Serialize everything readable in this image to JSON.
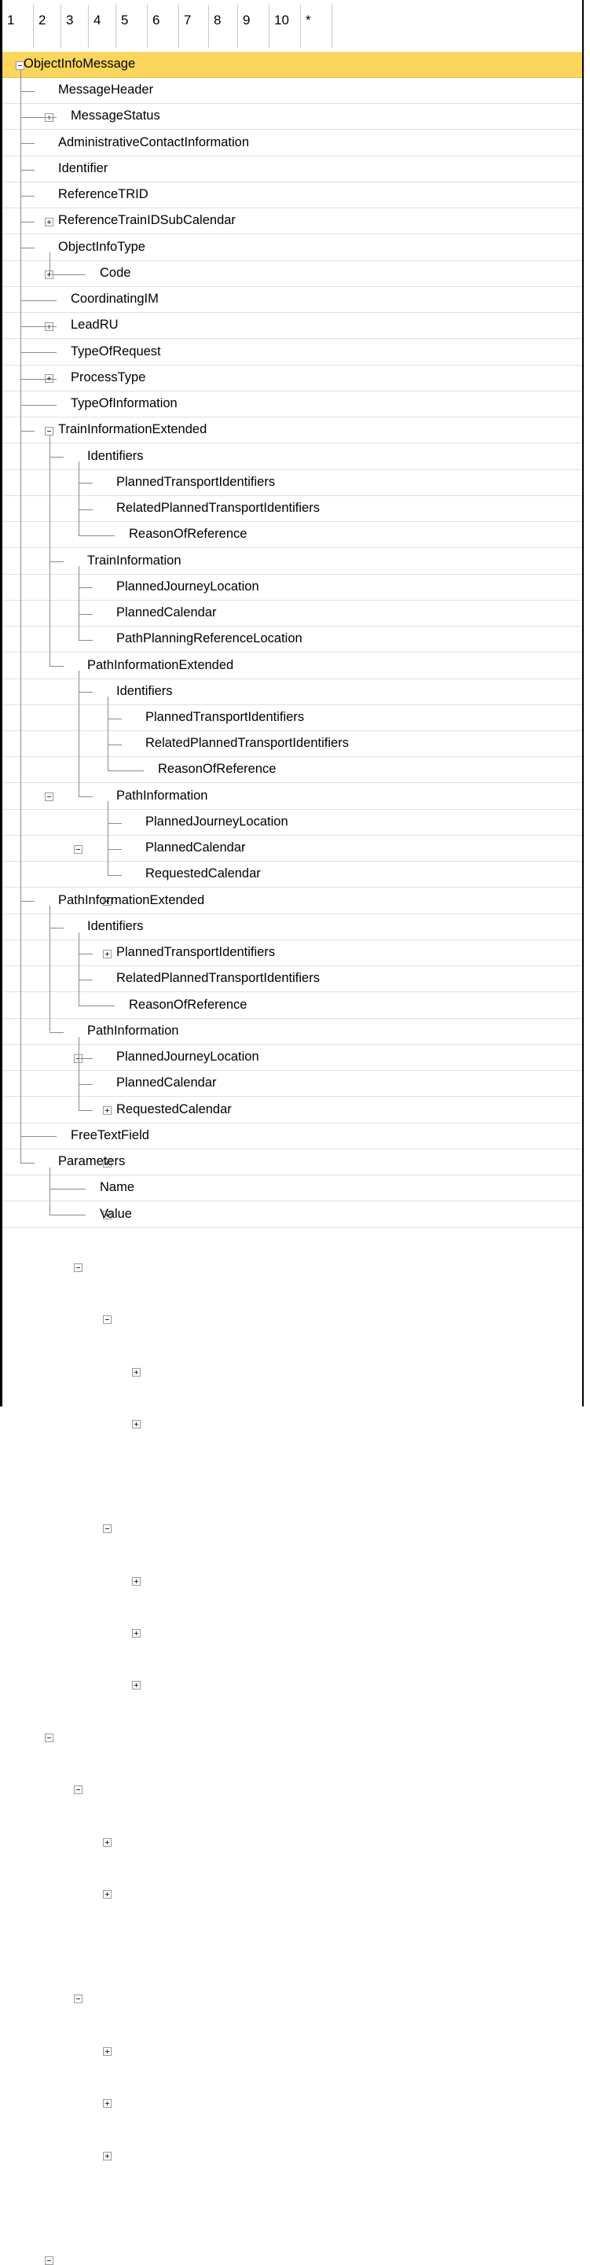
{
  "header": {
    "columns": [
      "1",
      "2",
      "3",
      "4",
      "5",
      "6",
      "7",
      "8",
      "9",
      "10",
      "*"
    ]
  },
  "tree": [
    {
      "label": "ObjectInfoMessage",
      "depth": 0,
      "toggle": "minus",
      "selected": true
    },
    {
      "label": "MessageHeader",
      "depth": 1,
      "toggle": "plus"
    },
    {
      "label": "MessageStatus",
      "depth": 1,
      "toggle": "none"
    },
    {
      "label": "AdministrativeContactInformation",
      "depth": 1,
      "toggle": "plus"
    },
    {
      "label": "Identifier",
      "depth": 1,
      "toggle": "plus"
    },
    {
      "label": "ReferenceTRID",
      "depth": 1,
      "toggle": "plus"
    },
    {
      "label": "ReferenceTrainIDSubCalendar",
      "depth": 1,
      "toggle": "plus"
    },
    {
      "label": "ObjectInfoType",
      "depth": 1,
      "toggle": "minus"
    },
    {
      "label": "Code",
      "depth": 2,
      "toggle": "none"
    },
    {
      "label": "CoordinatingIM",
      "depth": 1,
      "toggle": "none"
    },
    {
      "label": "LeadRU",
      "depth": 1,
      "toggle": "none"
    },
    {
      "label": "TypeOfRequest",
      "depth": 1,
      "toggle": "none"
    },
    {
      "label": "ProcessType",
      "depth": 1,
      "toggle": "none"
    },
    {
      "label": "TypeOfInformation",
      "depth": 1,
      "toggle": "none"
    },
    {
      "label": "TrainInformationExtended",
      "depth": 1,
      "toggle": "minus"
    },
    {
      "label": "Identifiers",
      "depth": 2,
      "toggle": "minus"
    },
    {
      "label": "PlannedTransportIdentifiers",
      "depth": 3,
      "toggle": "plus"
    },
    {
      "label": "RelatedPlannedTransportIdentifiers",
      "depth": 3,
      "toggle": "plus"
    },
    {
      "label": "ReasonOfReference",
      "depth": 3,
      "toggle": "none"
    },
    {
      "label": "TrainInformation",
      "depth": 2,
      "toggle": "minus"
    },
    {
      "label": "PlannedJourneyLocation",
      "depth": 3,
      "toggle": "plus"
    },
    {
      "label": "PlannedCalendar",
      "depth": 3,
      "toggle": "plus"
    },
    {
      "label": "PathPlanningReferenceLocation",
      "depth": 3,
      "toggle": "plus"
    },
    {
      "label": "PathInformationExtended",
      "depth": 2,
      "toggle": "minus"
    },
    {
      "label": "Identifiers",
      "depth": 3,
      "toggle": "minus"
    },
    {
      "label": "PlannedTransportIdentifiers",
      "depth": 4,
      "toggle": "plus"
    },
    {
      "label": "RelatedPlannedTransportIdentifiers",
      "depth": 4,
      "toggle": "plus"
    },
    {
      "label": "ReasonOfReference",
      "depth": 4,
      "toggle": "none"
    },
    {
      "label": "PathInformation",
      "depth": 3,
      "toggle": "minus"
    },
    {
      "label": "PlannedJourneyLocation",
      "depth": 4,
      "toggle": "plus"
    },
    {
      "label": "PlannedCalendar",
      "depth": 4,
      "toggle": "plus"
    },
    {
      "label": "RequestedCalendar",
      "depth": 4,
      "toggle": "plus"
    },
    {
      "label": "PathInformationExtended",
      "depth": 1,
      "toggle": "minus"
    },
    {
      "label": "Identifiers",
      "depth": 2,
      "toggle": "minus"
    },
    {
      "label": "PlannedTransportIdentifiers",
      "depth": 3,
      "toggle": "plus"
    },
    {
      "label": "RelatedPlannedTransportIdentifiers",
      "depth": 3,
      "toggle": "plus"
    },
    {
      "label": "ReasonOfReference",
      "depth": 3,
      "toggle": "none"
    },
    {
      "label": "PathInformation",
      "depth": 2,
      "toggle": "minus"
    },
    {
      "label": "PlannedJourneyLocation",
      "depth": 3,
      "toggle": "plus"
    },
    {
      "label": "PlannedCalendar",
      "depth": 3,
      "toggle": "plus"
    },
    {
      "label": "RequestedCalendar",
      "depth": 3,
      "toggle": "plus"
    },
    {
      "label": "FreeTextField",
      "depth": 1,
      "toggle": "none"
    },
    {
      "label": "Parameters",
      "depth": 1,
      "toggle": "minus"
    },
    {
      "label": "Name",
      "depth": 2,
      "toggle": "none"
    },
    {
      "label": "Value",
      "depth": 2,
      "toggle": "none"
    }
  ]
}
